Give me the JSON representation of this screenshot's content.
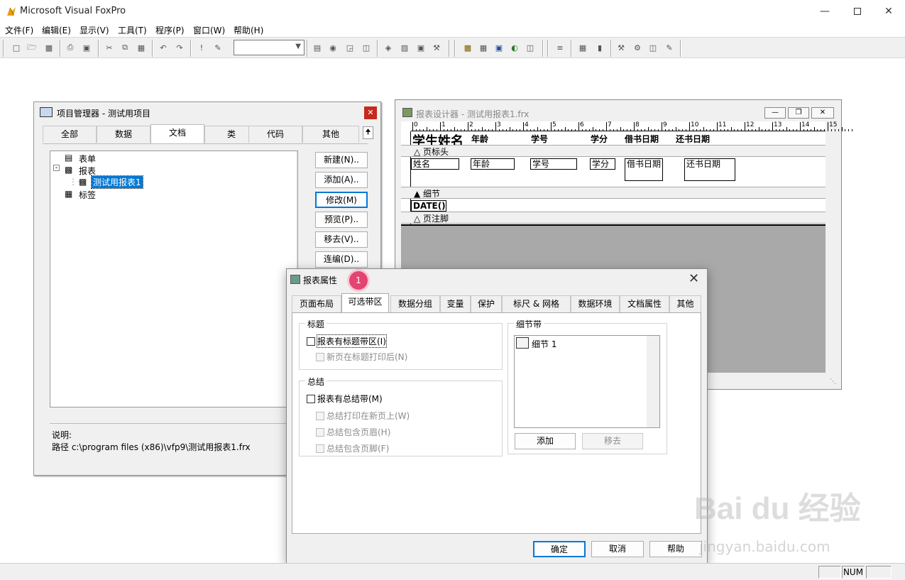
{
  "app": {
    "title": "Microsoft Visual FoxPro"
  },
  "menu": [
    "文件(F)",
    "编辑(E)",
    "显示(V)",
    "工具(T)",
    "程序(P)",
    "窗口(W)",
    "帮助(H)"
  ],
  "project_manager": {
    "title": "项目管理器 - 测试用项目",
    "tabs": [
      "全部",
      "数据",
      "文档",
      "类",
      "代码",
      "其他"
    ],
    "active_tab": "文档",
    "tree": [
      "表单",
      "报表",
      "测试用报表1",
      "标签"
    ],
    "buttons": [
      "新建(N)..",
      "添加(A)..",
      "修改(M)",
      "预览(P)..",
      "移去(V)..",
      "连编(D).."
    ],
    "desc_label": "说明:",
    "path": "路径 c:\\program files (x86)\\vfp9\\测试用报表1.frx"
  },
  "report_designer": {
    "title": "报表设计器 - 测试用报表1.frx",
    "ruler": [
      "0",
      "1",
      "2",
      "3",
      "4",
      "5",
      "6",
      "7",
      "8",
      "9",
      "10",
      "11",
      "12",
      "13",
      "14",
      "15"
    ],
    "page_title_text": "学生姓名",
    "headers": [
      "年龄",
      "学号",
      "学分",
      "借书日期",
      "还书日期"
    ],
    "bands": [
      "页标头",
      "细节",
      "页注脚"
    ],
    "fields": [
      "姓名",
      "年龄",
      "学号",
      "学分",
      "借书日期",
      "还书日期"
    ],
    "footer_field": "DATE()"
  },
  "dialog": {
    "title": "报表属性",
    "badge": "1",
    "tabs": [
      "页面布局",
      "可选带区",
      "数据分组",
      "变量",
      "保护",
      "标尺 & 网格",
      "数据环境",
      "文档属性",
      "其他"
    ],
    "active_tab": "可选带区",
    "title_group": "标题",
    "title_checks": [
      "报表有标题带区(I)",
      "新页在标题打印后(N)"
    ],
    "summary_group": "总结",
    "summary_checks": [
      "报表有总结带(M)",
      "总结打印在新页上(W)",
      "总结包含页眉(H)",
      "总结包含页脚(F)"
    ],
    "detail_group": "细节带",
    "detail_items": [
      "细节 1"
    ],
    "detail_add": "添加",
    "detail_remove": "移去",
    "ok": "确定",
    "cancel": "取消",
    "help": "帮助"
  },
  "status": {
    "num": "NUM"
  },
  "watermark": {
    "brand": "Bai du 经验",
    "url": "jingyan.baidu.com"
  },
  "colors": {
    "accent_badge": "#e2456f",
    "selection": "#0078d7"
  }
}
